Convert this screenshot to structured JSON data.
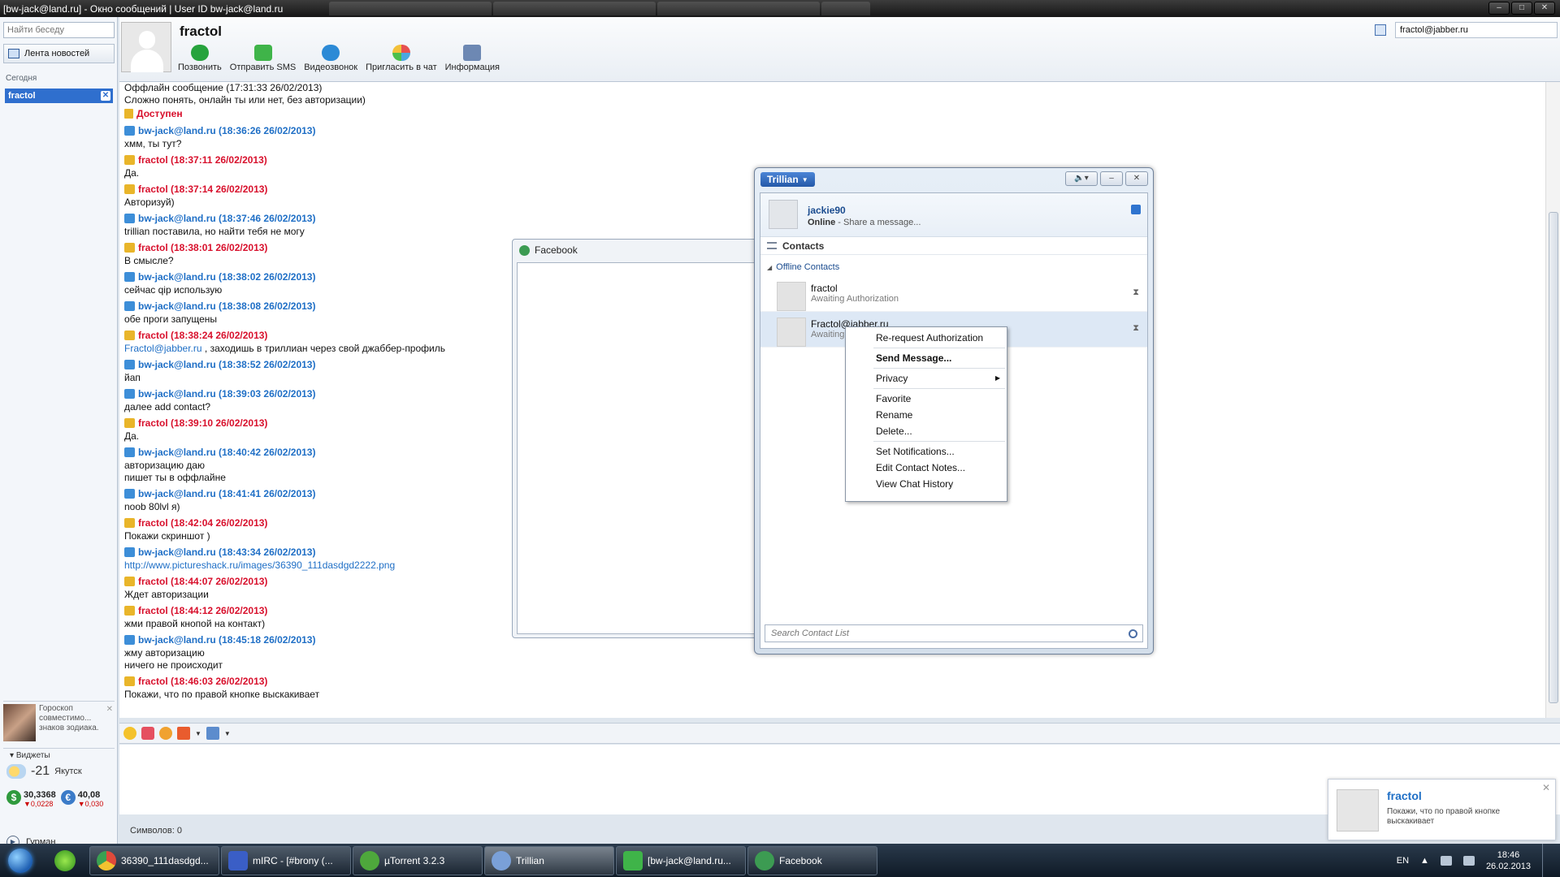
{
  "window": {
    "title": "[bw-jack@land.ru] - Окно сообщений | User ID bw-jack@land.ru"
  },
  "sidebar": {
    "search_placeholder": "Найти беседу",
    "newsfeed_label": "Лента новостей",
    "section_today": "Сегодня",
    "active_contact": "fractol",
    "horoscope_text": "Гороскоп совместимо... знаков зодиака.",
    "widgets_label": "Виджеты",
    "weather": {
      "temp": "-21",
      "city": "Якутск"
    },
    "currency": [
      {
        "symbol": "$",
        "value": "30,3368",
        "change": "▼0,0228"
      },
      {
        "symbol": "€",
        "value": "40,08",
        "change": "▼0,030"
      }
    ],
    "gurman_label": "Гурман"
  },
  "header": {
    "contact_name": "fractol",
    "jid": "fractol@jabber.ru",
    "actions": [
      {
        "label": "Позвонить",
        "icon": "phone-icon"
      },
      {
        "label": "Отправить SMS",
        "icon": "sms-icon"
      },
      {
        "label": "Видеозвонок",
        "icon": "video-icon"
      },
      {
        "label": "Пригласить в чат",
        "icon": "invite-icon"
      },
      {
        "label": "Информация",
        "icon": "info-icon"
      }
    ]
  },
  "chat": {
    "intro": [
      "Оффлайн сообщение (17:31:33 26/02/2013)",
      "Сложно понять, онлайн ты или нет, без авторизации)"
    ],
    "status": "Доступен",
    "messages": [
      {
        "author": "bw-jack@land.ru (18:36:26 26/02/2013)",
        "from": "me",
        "lines": [
          "хмм, ты тут?"
        ]
      },
      {
        "author": "fractol (18:37:11 26/02/2013)",
        "from": "them",
        "lines": [
          "Да."
        ]
      },
      {
        "author": "fractol (18:37:14 26/02/2013)",
        "from": "them",
        "lines": [
          "Авторизуй)"
        ]
      },
      {
        "author": "bw-jack@land.ru (18:37:46 26/02/2013)",
        "from": "me",
        "lines": [
          "trillian поставила, но найти тебя не могу"
        ]
      },
      {
        "author": "fractol (18:38:01 26/02/2013)",
        "from": "them",
        "lines": [
          "В смысле?"
        ]
      },
      {
        "author": "bw-jack@land.ru (18:38:02 26/02/2013)",
        "from": "me",
        "lines": [
          "сейчас qip использую"
        ]
      },
      {
        "author": "bw-jack@land.ru (18:38:08 26/02/2013)",
        "from": "me",
        "lines": [
          "обе проги запущены"
        ]
      },
      {
        "author": "fractol (18:38:24 26/02/2013)",
        "from": "them",
        "link": "Fractol@jabber.ru",
        "lines": [
          " , заходишь в триллиан через свой джаббер-профиль"
        ]
      },
      {
        "author": "bw-jack@land.ru (18:38:52 26/02/2013)",
        "from": "me",
        "lines": [
          "йап"
        ]
      },
      {
        "author": "bw-jack@land.ru (18:39:03 26/02/2013)",
        "from": "me",
        "lines": [
          "далее add contact?"
        ]
      },
      {
        "author": "fractol (18:39:10 26/02/2013)",
        "from": "them",
        "lines": [
          "Да."
        ]
      },
      {
        "author": "bw-jack@land.ru (18:40:42 26/02/2013)",
        "from": "me",
        "lines": [
          "авторизацию даю",
          "пишет ты в оффлайне"
        ]
      },
      {
        "author": "bw-jack@land.ru (18:41:41 26/02/2013)",
        "from": "me",
        "lines": [
          "noob 80lvl я)"
        ]
      },
      {
        "author": "fractol (18:42:04 26/02/2013)",
        "from": "them",
        "lines": [
          "Покажи скриншот )"
        ]
      },
      {
        "author": "bw-jack@land.ru (18:43:34 26/02/2013)",
        "from": "me",
        "link": "http://www.pictureshack.ru/images/36390_111dasdgd2222.png",
        "lines": []
      },
      {
        "author": "fractol (18:44:07 26/02/2013)",
        "from": "them",
        "lines": [
          "Ждет авторизации"
        ]
      },
      {
        "author": "fractol (18:44:12 26/02/2013)",
        "from": "them",
        "lines": [
          "жми правой кнопой на контакт)"
        ]
      },
      {
        "author": "bw-jack@land.ru (18:45:18 26/02/2013)",
        "from": "me",
        "lines": [
          "жму авторизацию",
          "ничего не происходит"
        ]
      },
      {
        "author": "fractol (18:46:03 26/02/2013)",
        "from": "them",
        "lines": [
          "Покажи, что по правой кнопке выскакивает"
        ]
      }
    ]
  },
  "composer": {
    "counter_label": "Символов:",
    "counter_value": "0"
  },
  "facebook_window": {
    "title": "Facebook"
  },
  "trillian": {
    "brand": "Trillian",
    "profile": {
      "name": "jackie90",
      "status_bold": "Online",
      "status_msg": " - Share a message..."
    },
    "contacts_label": "Contacts",
    "group_label": "Offline Contacts",
    "contacts": [
      {
        "name": "fractol",
        "status": "Awaiting Authorization"
      },
      {
        "name": "Fractol@jabber.ru",
        "status": "Awaiting Authorization"
      }
    ],
    "search_placeholder": "Search Contact List"
  },
  "context_menu": {
    "items": [
      {
        "label": "Re-request Authorization",
        "bold": false
      },
      {
        "label": "Send Message...",
        "bold": true
      },
      {
        "label": "Privacy",
        "bold": false,
        "submenu": true
      },
      {
        "label": "Favorite",
        "bold": false
      },
      {
        "label": "Rename",
        "bold": false
      },
      {
        "label": "Delete...",
        "bold": false
      },
      {
        "label": "Set Notifications...",
        "bold": false
      },
      {
        "label": "Edit Contact Notes...",
        "bold": false
      },
      {
        "label": "View Chat History",
        "bold": false
      }
    ]
  },
  "toast": {
    "name": "fractol",
    "message": "Покажи, что по правой кнопке выскакивает"
  },
  "taskbar": {
    "tasks": [
      {
        "label": "36390_111dasdgd...",
        "icon": "chrome-icon"
      },
      {
        "label": "mIRC - [#brony (...",
        "icon": "mirc-icon"
      },
      {
        "label": "µTorrent 3.2.3",
        "icon": "utorrent-icon"
      },
      {
        "label": "Trillian",
        "icon": "trillian-icon"
      },
      {
        "label": "[bw-jack@land.ru...",
        "icon": "qip-icon"
      },
      {
        "label": "Facebook",
        "icon": "facebook-icon"
      }
    ],
    "lang": "EN",
    "time": "18:46",
    "date": "26.02.2013"
  },
  "colors": {
    "me": "#1f6fc6",
    "them": "#d8102c",
    "accent": "#2f6fce"
  }
}
